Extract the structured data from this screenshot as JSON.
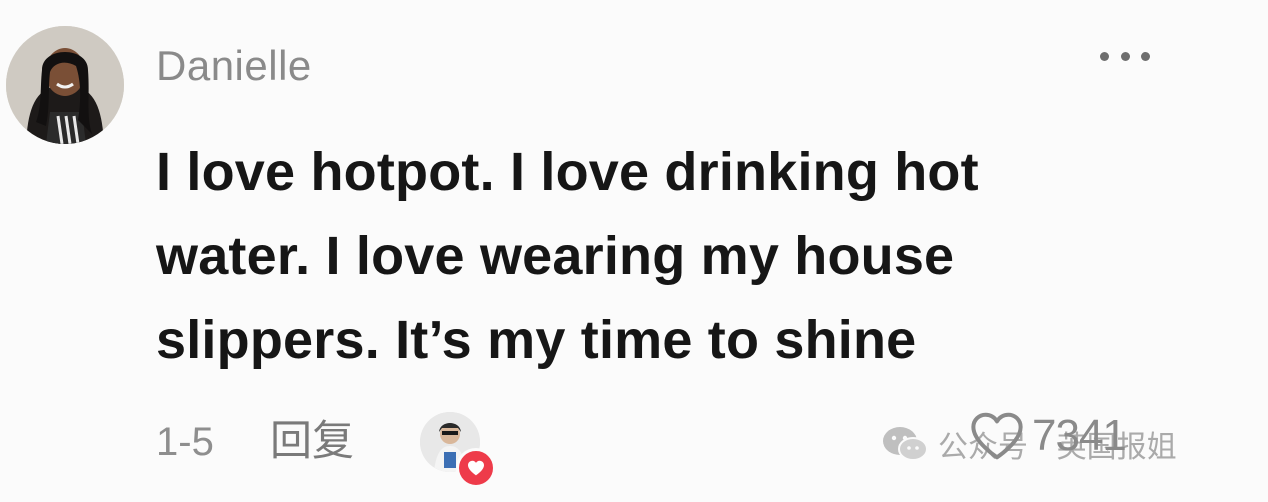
{
  "comment": {
    "username": "Danielle",
    "text": "I love hotpot. I love drinking hot water. I love wearing my house slippers. It’s my time to shine",
    "date": "1-5",
    "reply_label": "回复",
    "like_count": "7341",
    "creator_liked": true
  },
  "watermark": {
    "text": "公众号 · 英国报姐"
  },
  "colors": {
    "background": "#fbfbfb",
    "username": "#8a8a8a",
    "comment_text": "#161616",
    "meta": "#8e8e8e",
    "heart_badge": "#ee3b4a"
  },
  "icons": {
    "more": "more-horizontal-icon",
    "like": "heart-outline-icon",
    "creator_like": "heart-filled-icon",
    "watermark": "wechat-icon"
  }
}
